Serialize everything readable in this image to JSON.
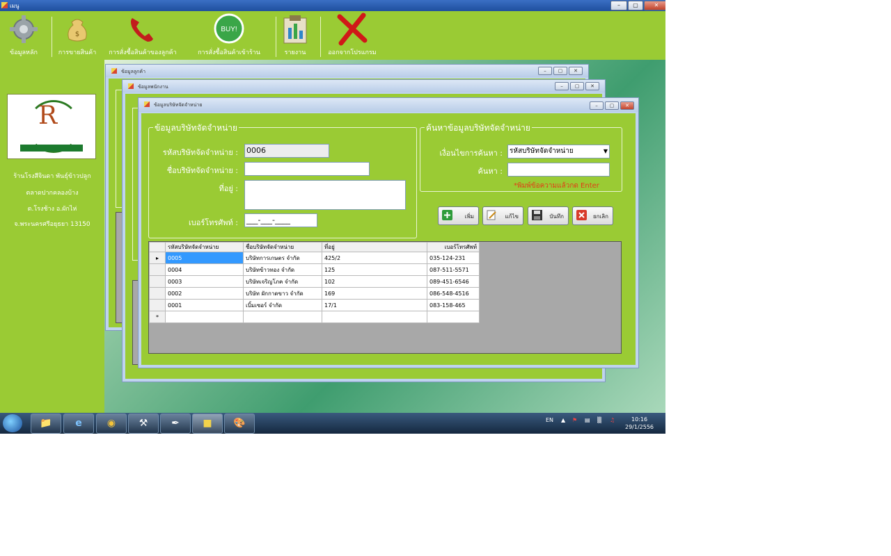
{
  "app": {
    "title": "เมนู"
  },
  "toolbar": {
    "items": [
      {
        "label": "ข้อมูลหลัก",
        "icon": "gear-icon"
      },
      {
        "label": "การขายสินค้า",
        "icon": "money-bag-icon"
      },
      {
        "label": "การสั่งซื้อสินค้าของลูกค้า",
        "icon": "phone-icon"
      },
      {
        "label": "การสั่งซื้อสินค้าเข้าร้าน",
        "icon": "buy-tag-icon"
      },
      {
        "label": "รายงาน",
        "icon": "report-icon"
      },
      {
        "label": "ออกจากโปรแกรม",
        "icon": "exit-x-icon"
      }
    ]
  },
  "store": {
    "line1": "ร้านโรงสีจินดา พันธุ์ข้าวปลูก",
    "line2": "ตลาดปากคลองบ้าง",
    "line3": "ต.โรงช้าง อ.ผักไห่",
    "line4": "จ.พระนครศรีอยุธยา 13150"
  },
  "windows": {
    "back1_title": "ข้อมูลลูกค้า",
    "back2_title": "ข้อมูลพนักงาน",
    "front_title": "ข้อมูลบริษัทจัดจำหน่าย"
  },
  "form": {
    "group_title": "ข้อมูลบริษัทจัดจำหน่าย",
    "id_label": "รหัสบริษัทจัดจำหน่าย :",
    "id_value": "0006",
    "name_label": "ชื่อบริษัทจัดจำหน่าย :",
    "name_value": "",
    "address_label": "ที่อยู่ :",
    "address_value": "",
    "phone_label": "เบอร์โทรศัพท์ :",
    "phone_value": "___-___-____"
  },
  "search": {
    "group_title": "ค้นหาข้อมูลบริษัทจัดจำหน่าย",
    "cond_label": "เงื่อนไขการค้นหา :",
    "cond_value": "รหัสบริษัทจัดจำหน่าย",
    "query_label": "ค้นหา :",
    "query_value": "",
    "hint": "*พิมพ์ข้อความแล้วกด Enter"
  },
  "actions": {
    "add": "เพิ่ม",
    "edit": "แก้ไข",
    "save": "บันทึก",
    "cancel": "ยกเลิก"
  },
  "grid": {
    "headers": [
      "รหัสบริษัทจัดจำหน่าย",
      "ชื่อบริษัทจัดจำหน่าย",
      "ที่อยู่",
      "เบอร์โทรศัพท์"
    ],
    "rows": [
      [
        "0005",
        "บริษัทการเกษตร จำกัด",
        "425/2",
        "035-124-231"
      ],
      [
        "0004",
        "บริษัทข้าวทอง จำกัด",
        "125",
        "087-511-5571"
      ],
      [
        "0003",
        "บริษัทเจริญโภค จำกัด",
        "102",
        "089-451-6546"
      ],
      [
        "0002",
        "บริษัท ผักกาดขาว จำกัด",
        "169",
        "086-548-4516"
      ],
      [
        "0001",
        "เบิ้มเซอร์ จำกัด",
        "17/1",
        "083-158-465"
      ]
    ]
  },
  "taskbar": {
    "lang": "EN",
    "time": "10:16",
    "date": "29/1/2556"
  }
}
